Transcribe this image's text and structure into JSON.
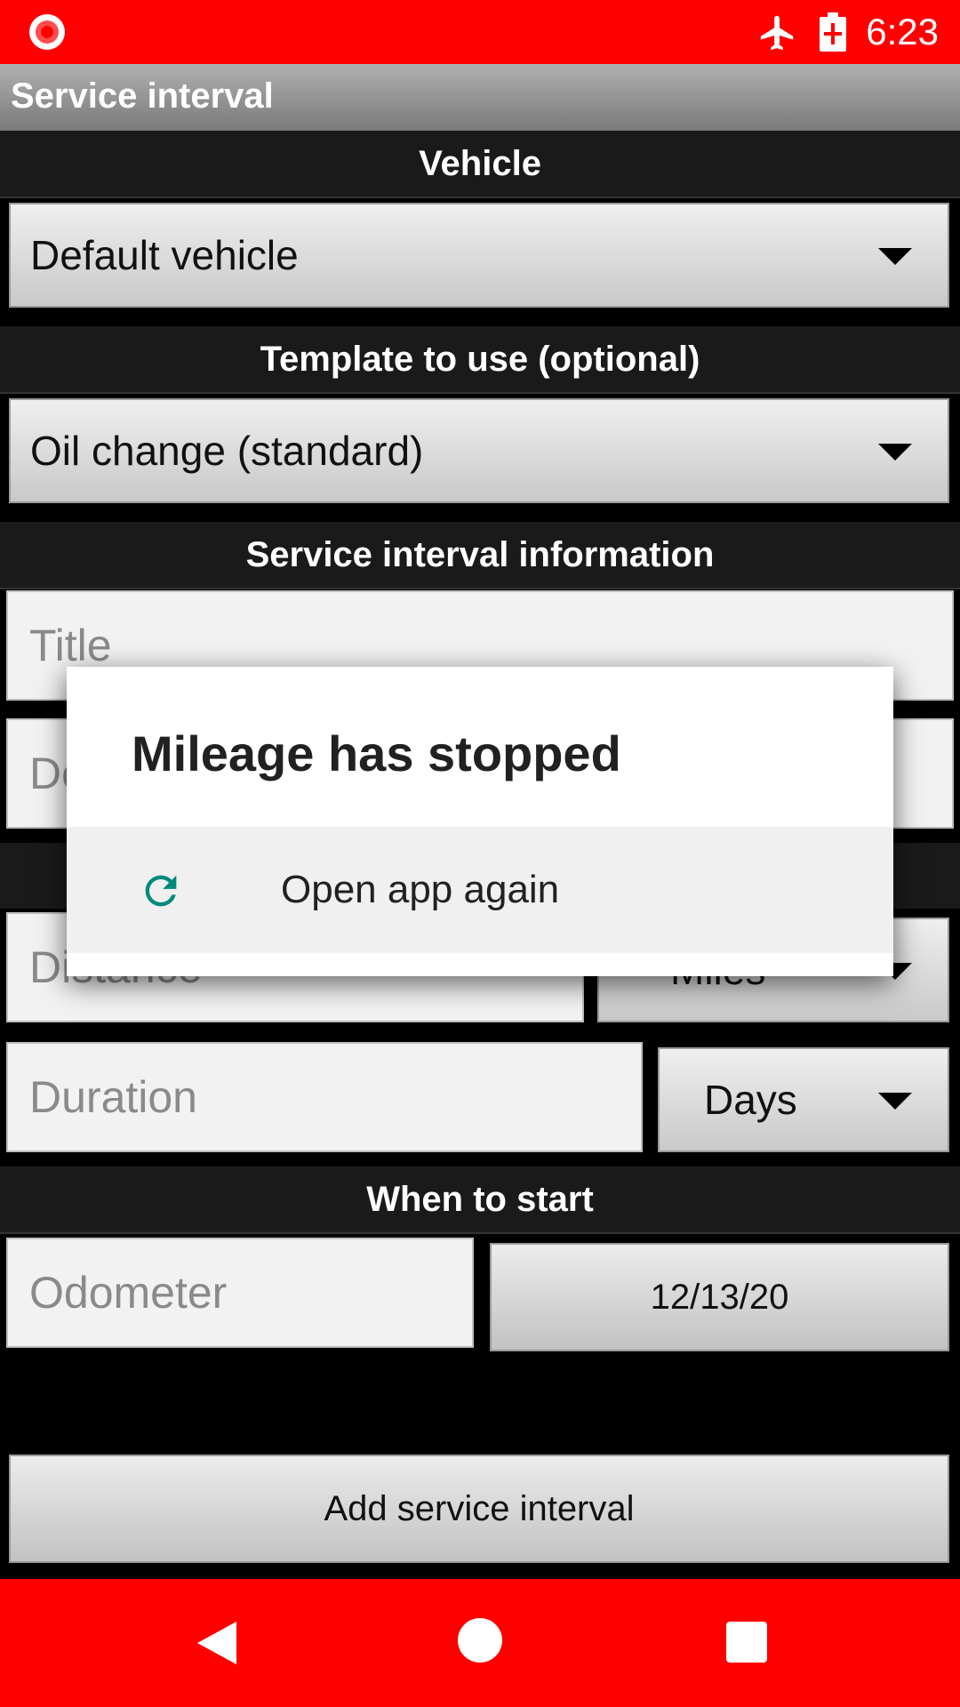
{
  "status_bar": {
    "time": "6:23",
    "icons": [
      "record-icon",
      "airplane-mode-icon",
      "battery-charging-icon"
    ]
  },
  "app": {
    "title": "Service interval"
  },
  "sections": {
    "vehicle": "Vehicle",
    "template": "Template to use (optional)",
    "info": "Service interval information",
    "start": "When to start"
  },
  "vehicle_spinner": {
    "value": "Default vehicle"
  },
  "template_spinner": {
    "value": "Oil change (standard)"
  },
  "fields": {
    "title_placeholder": "Title",
    "description_placeholder_partial": "De",
    "distance_placeholder": "Distance",
    "distance_unit": "Miles",
    "duration_placeholder": "Duration",
    "duration_unit": "Days",
    "odometer_placeholder": "Odometer",
    "start_date": "12/13/20"
  },
  "add_button": "Add service interval",
  "dialog": {
    "title": "Mileage has stopped",
    "action_label": "Open app again",
    "action_icon": "refresh-icon",
    "accent": "#00897b"
  },
  "nav": {
    "icons": [
      "back-icon",
      "home-icon",
      "recents-icon"
    ]
  },
  "colors": {
    "status_bar": "#ff0000",
    "nav_bar": "#ff0000"
  }
}
